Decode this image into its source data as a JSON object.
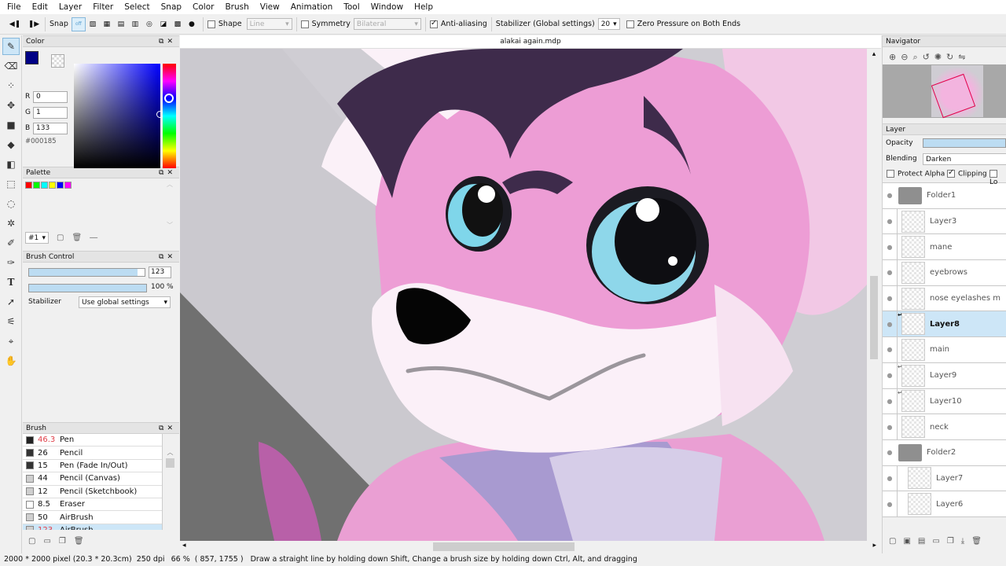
{
  "menu": [
    "File",
    "Edit",
    "Layer",
    "Filter",
    "Select",
    "Snap",
    "Color",
    "Brush",
    "View",
    "Animation",
    "Tool",
    "Window",
    "Help"
  ],
  "toolbar": {
    "snap_label": "Snap",
    "shape_label": "Shape",
    "shape_value": "Line",
    "symmetry_label": "Symmetry",
    "symmetry_value": "Bilateral",
    "antialias_label": "Anti-aliasing",
    "stabilizer_label": "Stabilizer (Global settings)",
    "stabilizer_value": "20",
    "zero_pressure_label": "Zero Pressure on Both Ends"
  },
  "color_panel": {
    "title": "Color",
    "r_label": "R",
    "r_value": "0",
    "g_label": "G",
    "g_value": "1",
    "b_label": "B",
    "b_value": "133",
    "hex": "#000185",
    "current_color": "#000185"
  },
  "palette_panel": {
    "title": "Palette",
    "swatches": [
      "#ff0000",
      "#00ff00",
      "#00ffff",
      "#ffff00",
      "#0000ff",
      "#ff00ff"
    ],
    "set_label": "#1"
  },
  "brush_control": {
    "title": "Brush Control",
    "size_value": "123",
    "opacity_value": "100 %",
    "stabilizer_label": "Stabilizer",
    "stabilizer_value": "Use global settings"
  },
  "brush_panel": {
    "title": "Brush",
    "items": [
      {
        "size": "46.3",
        "name": "Pen",
        "color": "#222222"
      },
      {
        "size": "26",
        "name": "Pencil",
        "color": "#333333"
      },
      {
        "size": "15",
        "name": "Pen (Fade In/Out)",
        "color": "#333333"
      },
      {
        "size": "44",
        "name": "Pencil (Canvas)",
        "color": "#cfcfcf"
      },
      {
        "size": "12",
        "name": "Pencil (Sketchbook)",
        "color": "#cfcfcf"
      },
      {
        "size": "8.5",
        "name": "Eraser",
        "color": "#ffffff"
      },
      {
        "size": "50",
        "name": "AirBrush",
        "color": "#cfcfcf"
      },
      {
        "size": "123",
        "name": "AirBrush",
        "color": "#cfcfcf"
      }
    ]
  },
  "document": {
    "tab_title": "alakai again.mdp"
  },
  "navigator": {
    "title": "Navigator"
  },
  "layer_panel": {
    "title": "Layer",
    "opacity_label": "Opacity",
    "opacity_fraction": 1.0,
    "blending_label": "Blending",
    "blending_value": "Darken",
    "protect_alpha_label": "Protect Alpha",
    "clipping_label": "Clipping",
    "lock_label": "Lo",
    "layers": [
      {
        "name": "Folder1"
      },
      {
        "name": "Layer3"
      },
      {
        "name": "mane"
      },
      {
        "name": "eyebrows"
      },
      {
        "name": "nose eyelashes m"
      },
      {
        "name": "Layer8"
      },
      {
        "name": "main"
      },
      {
        "name": "Layer9"
      },
      {
        "name": "Layer10"
      },
      {
        "name": "neck"
      },
      {
        "name": "Folder2"
      },
      {
        "name": "Layer7"
      },
      {
        "name": "Layer6"
      }
    ]
  },
  "status": {
    "canvas_size": "2000 * 2000 pixel",
    "physical_size": "(20.3 * 20.3cm)",
    "dpi": "250 dpi",
    "zoom": "66 %",
    "cursor": "( 857, 1755 )",
    "hint": "Draw a straight line by holding down Shift, Change a brush size by holding down Ctrl, Alt, and dragging"
  }
}
